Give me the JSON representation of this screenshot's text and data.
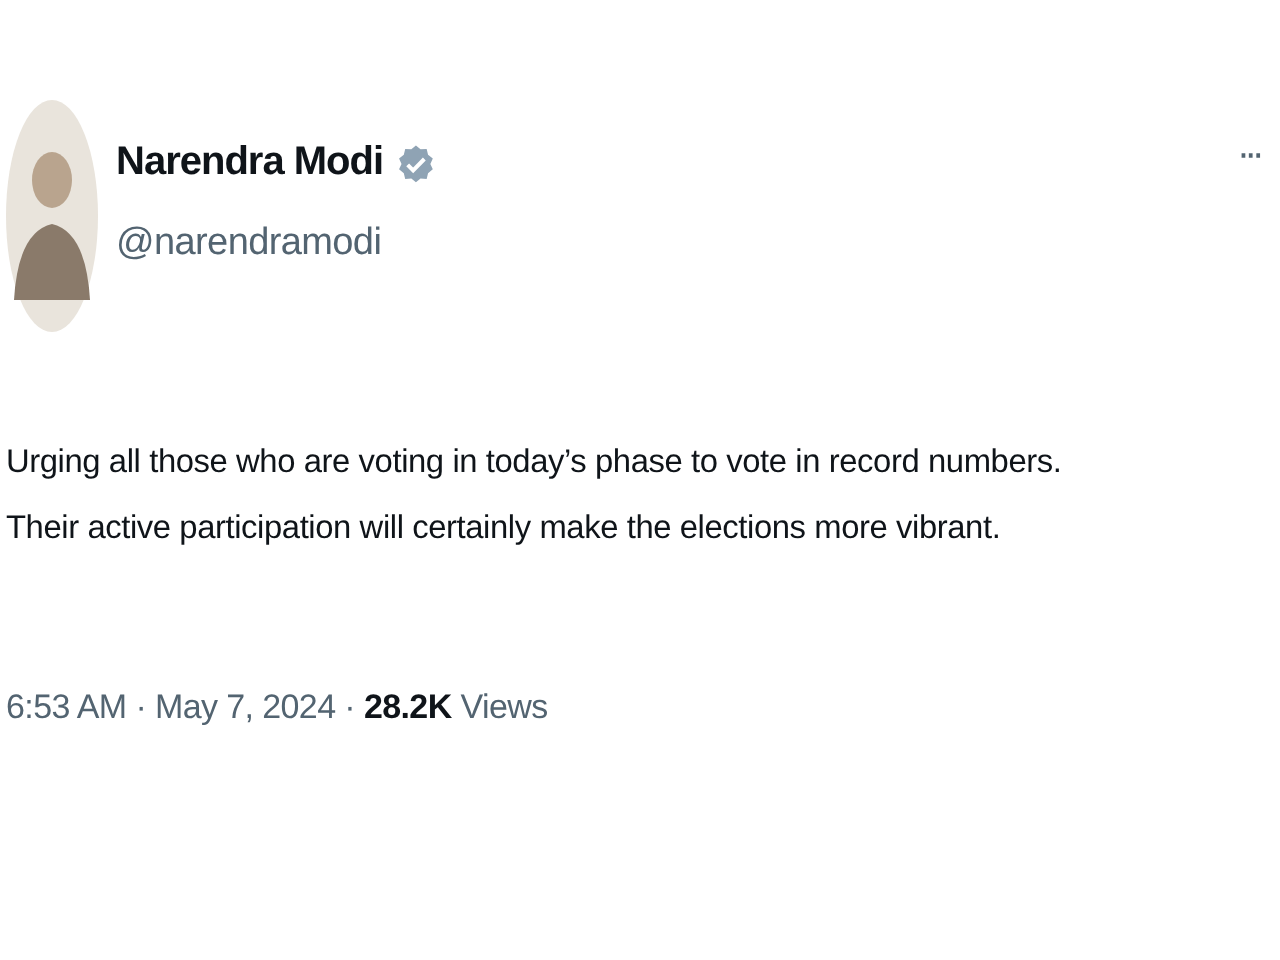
{
  "tweet": {
    "author": {
      "name": "Narendra Modi",
      "handle": "@narendramodi",
      "verified": true
    },
    "more": "···",
    "lines": [
      "Urging all those who are voting in today’s phase to vote in record numbers.",
      "Their active participation will certainly make the elections more vibrant."
    ],
    "meta": "6:53 AM · May 7, 2024 · **28.2K** Views"
  }
}
